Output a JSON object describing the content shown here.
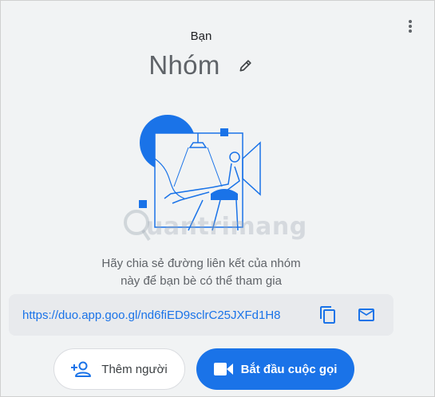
{
  "header": {
    "subtitle": "Bạn",
    "title": "Nhóm"
  },
  "icons": {
    "more": "more-vert-icon",
    "edit": "pencil-icon",
    "copy": "copy-icon",
    "mail": "mail-icon",
    "add_person": "person-add-icon",
    "video": "video-camera-icon"
  },
  "watermark": {
    "text": "uantrimang"
  },
  "description": {
    "line1": "Hãy chia sẻ đường liên kết của nhóm",
    "line2": "này để bạn bè có thể tham gia"
  },
  "link": {
    "url": "https://duo.app.goo.gl/nd6fiED9sclrC25JXFd1H8"
  },
  "actions": {
    "add_label": "Thêm người",
    "start_label": "Bắt đầu cuộc gọi"
  },
  "colors": {
    "accent": "#1a73e8",
    "background": "#f1f3f4",
    "link_box": "#e8eaed"
  }
}
